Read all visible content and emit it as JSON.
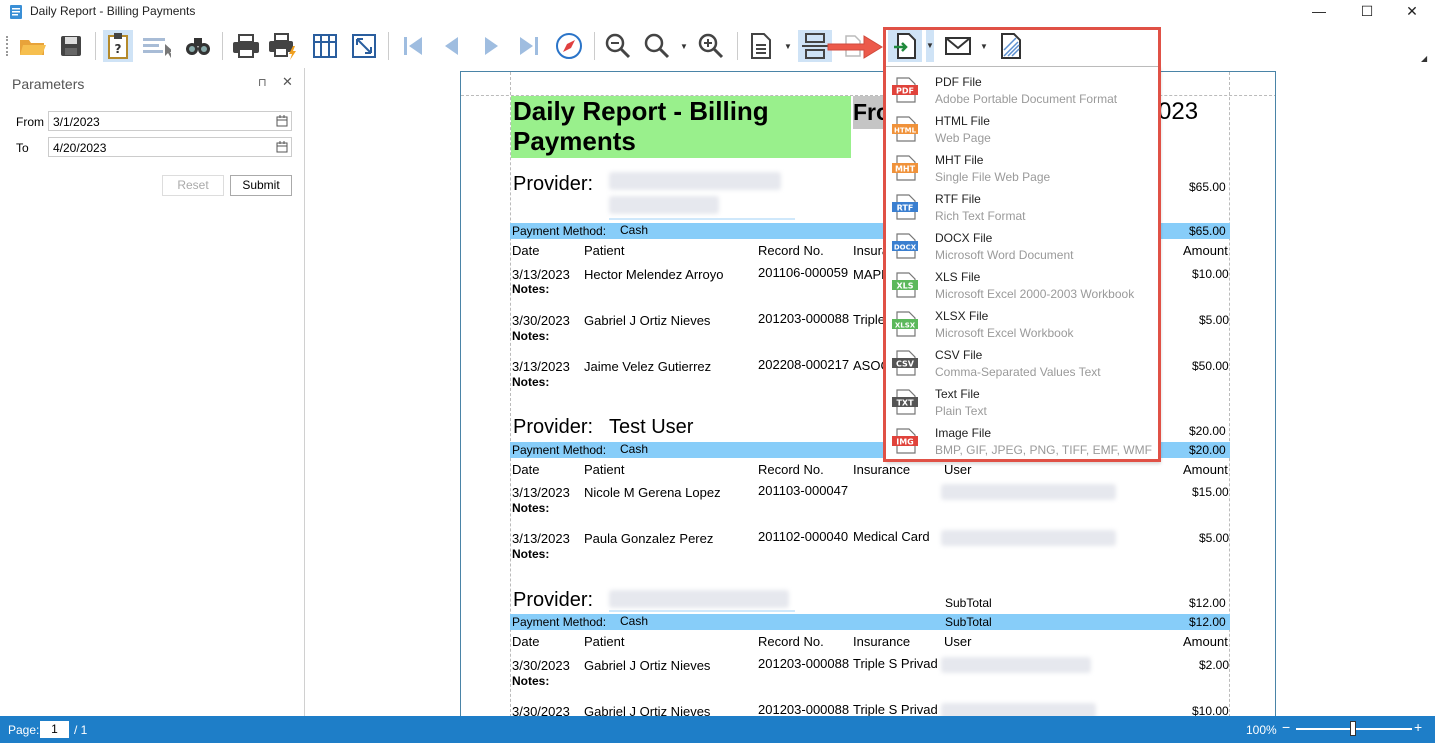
{
  "window": {
    "title": "Daily Report - Billing Payments",
    "min": "—",
    "max": "☐",
    "close": "✕"
  },
  "toolbar": {
    "icons": [
      "open-icon",
      "save-icon",
      "parameters-icon",
      "editing-fields-icon",
      "search-icon",
      "print-icon",
      "quick-print-icon",
      "page-setup-icon",
      "scale-icon",
      "first-page-icon",
      "previous-page-icon",
      "next-page-icon",
      "last-page-icon",
      "navigation-icon",
      "zoom-out-icon",
      "zoom-icon",
      "zoom-in-icon",
      "page-layout-icon",
      "multiple-pages-icon",
      "highlight-icon",
      "export-icon",
      "send-email-icon",
      "watermark-icon"
    ]
  },
  "parameters": {
    "title": "Parameters",
    "pin": "⊓",
    "close": "✕",
    "from_label": "From",
    "from_value": "3/1/2023",
    "to_label": "To",
    "to_value": "4/20/2023",
    "reset": "Reset",
    "submit": "Submit"
  },
  "report": {
    "title_line1": "Daily Report - Billing",
    "title_line2": "Payments",
    "from_partial": "Fro",
    "date_partial": "023",
    "provider_label": "Provider:",
    "payment_method_label": "Payment Method:",
    "cash": "Cash",
    "notes": "Notes:",
    "subtotal": "SubTotal",
    "headers": {
      "date": "Date",
      "patient": "Patient",
      "record": "Record No.",
      "insurance": "Insurance",
      "insurance_partial": "Insura",
      "user": "User",
      "amount": "Amount"
    },
    "group1": {
      "provider_total": "$65.00",
      "method_total": "$65.00",
      "rows": [
        {
          "date": "3/13/2023",
          "patient": "Hector Melendez Arroyo",
          "record": "201106-000059",
          "insurance": "MAPF",
          "amount": "$10.00"
        },
        {
          "date": "3/30/2023",
          "patient": "Gabriel J Ortiz Nieves",
          "record": "201203-000088",
          "insurance": "Triple",
          "amount": "$5.00"
        },
        {
          "date": "3/13/2023",
          "patient": "Jaime Velez Gutierrez",
          "record": "202208-000217",
          "insurance": "ASOC",
          "amount": "$50.00"
        }
      ]
    },
    "group2": {
      "provider": "Test User",
      "provider_total": "$20.00",
      "method_total": "$20.00",
      "rows": [
        {
          "date": "3/13/2023",
          "patient": "Nicole M Gerena Lopez",
          "record": "201103-000047",
          "insurance": "",
          "amount": "$15.00"
        },
        {
          "date": "3/13/2023",
          "patient": "Paula Gonzalez Perez",
          "record": "201102-000040",
          "insurance": "Medical Card",
          "amount": "$5.00"
        }
      ]
    },
    "group3": {
      "provider_total": "$12.00",
      "method_total": "$12.00",
      "rows": [
        {
          "date": "3/30/2023",
          "patient": "Gabriel J Ortiz Nieves",
          "record": "201203-000088",
          "insurance": "Triple S Privad",
          "amount": "$2.00"
        },
        {
          "date": "3/30/2023",
          "patient": "Gabriel J Ortiz Nieves",
          "record": "201203-000088",
          "insurance": "Triple S Privad",
          "amount": "$10.00"
        }
      ]
    }
  },
  "export_menu": [
    {
      "tag": "PDF",
      "color": "#e0433b",
      "name": "PDF File",
      "desc": "Adobe Portable Document Format"
    },
    {
      "tag": "HTML",
      "color": "#f0923a",
      "name": "HTML File",
      "desc": "Web Page"
    },
    {
      "tag": "MHT",
      "color": "#f0923a",
      "name": "MHT File",
      "desc": "Single File Web Page"
    },
    {
      "tag": "RTF",
      "color": "#3a7fd0",
      "name": "RTF File",
      "desc": "Rich Text Format"
    },
    {
      "tag": "DOCX",
      "color": "#3a7fd0",
      "name": "DOCX File",
      "desc": "Microsoft Word Document"
    },
    {
      "tag": "XLS",
      "color": "#5cb85c",
      "name": "XLS File",
      "desc": "Microsoft Excel 2000-2003 Workbook"
    },
    {
      "tag": "XLSX",
      "color": "#5cb85c",
      "name": "XLSX File",
      "desc": "Microsoft Excel Workbook"
    },
    {
      "tag": "CSV",
      "color": "#555555",
      "name": "CSV File",
      "desc": "Comma-Separated Values Text"
    },
    {
      "tag": "TXT",
      "color": "#555555",
      "name": "Text File",
      "desc": "Plain Text"
    },
    {
      "tag": "IMG",
      "color": "#e0433b",
      "name": "Image File",
      "desc": "BMP, GIF, JPEG, PNG, TIFF, EMF, WMF"
    }
  ],
  "status": {
    "page_label": "Page:",
    "page_value": "1",
    "page_total": "/ 1",
    "zoom": "100%",
    "minus": "−",
    "plus": "+"
  },
  "colors": {
    "accent": "#1e7ec8",
    "title_bg": "#99f08c",
    "band": "#87cdf9",
    "highlight": "#e05146"
  }
}
